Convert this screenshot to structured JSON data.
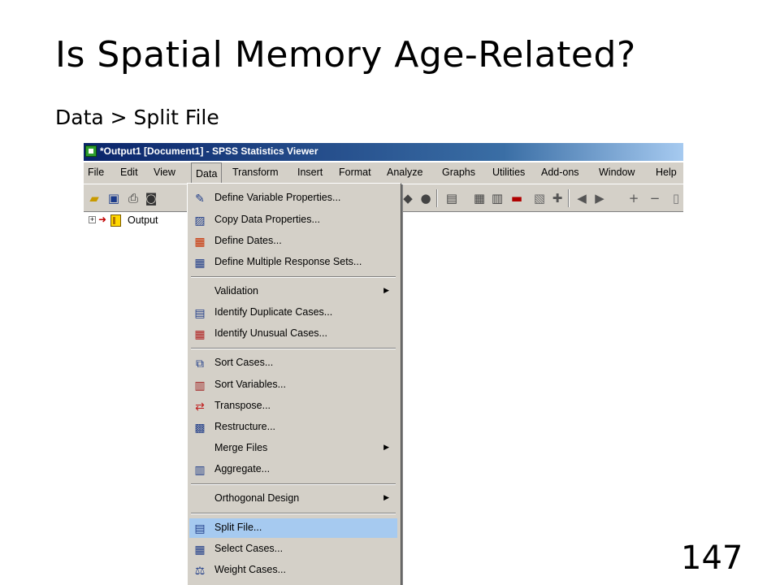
{
  "slide": {
    "title": "Is Spatial Memory Age-Related?",
    "subtitle": "Data > Split File",
    "page_number": "147"
  },
  "window": {
    "title": "*Output1 [Document1] - SPSS Statistics Viewer"
  },
  "menubar": {
    "file": "File",
    "edit": "Edit",
    "view": "View",
    "data": "Data",
    "transform": "Transform",
    "insert": "Insert",
    "format": "Format",
    "analyze": "Analyze",
    "graphs": "Graphs",
    "utilities": "Utilities",
    "addons": "Add-ons",
    "window": "Window",
    "help": "Help"
  },
  "tree": {
    "output_label": "Output"
  },
  "data_menu": {
    "define_variable_properties": "Define Variable Properties...",
    "copy_data_properties": "Copy Data Properties...",
    "define_dates": "Define Dates...",
    "define_multiple_response_sets": "Define Multiple Response Sets...",
    "validation": "Validation",
    "identify_duplicate_cases": "Identify Duplicate Cases...",
    "identify_unusual_cases": "Identify Unusual Cases...",
    "sort_cases": "Sort Cases...",
    "sort_variables": "Sort Variables...",
    "transpose": "Transpose...",
    "restructure": "Restructure...",
    "merge_files": "Merge Files",
    "aggregate": "Aggregate...",
    "orthogonal_design": "Orthogonal Design",
    "split_file": "Split File...",
    "select_cases": "Select Cases...",
    "weight_cases": "Weight Cases..."
  },
  "colors": {
    "titlebar": "#0a246a",
    "menu_face": "#d4d0c8",
    "highlight": "#a6caf0"
  }
}
